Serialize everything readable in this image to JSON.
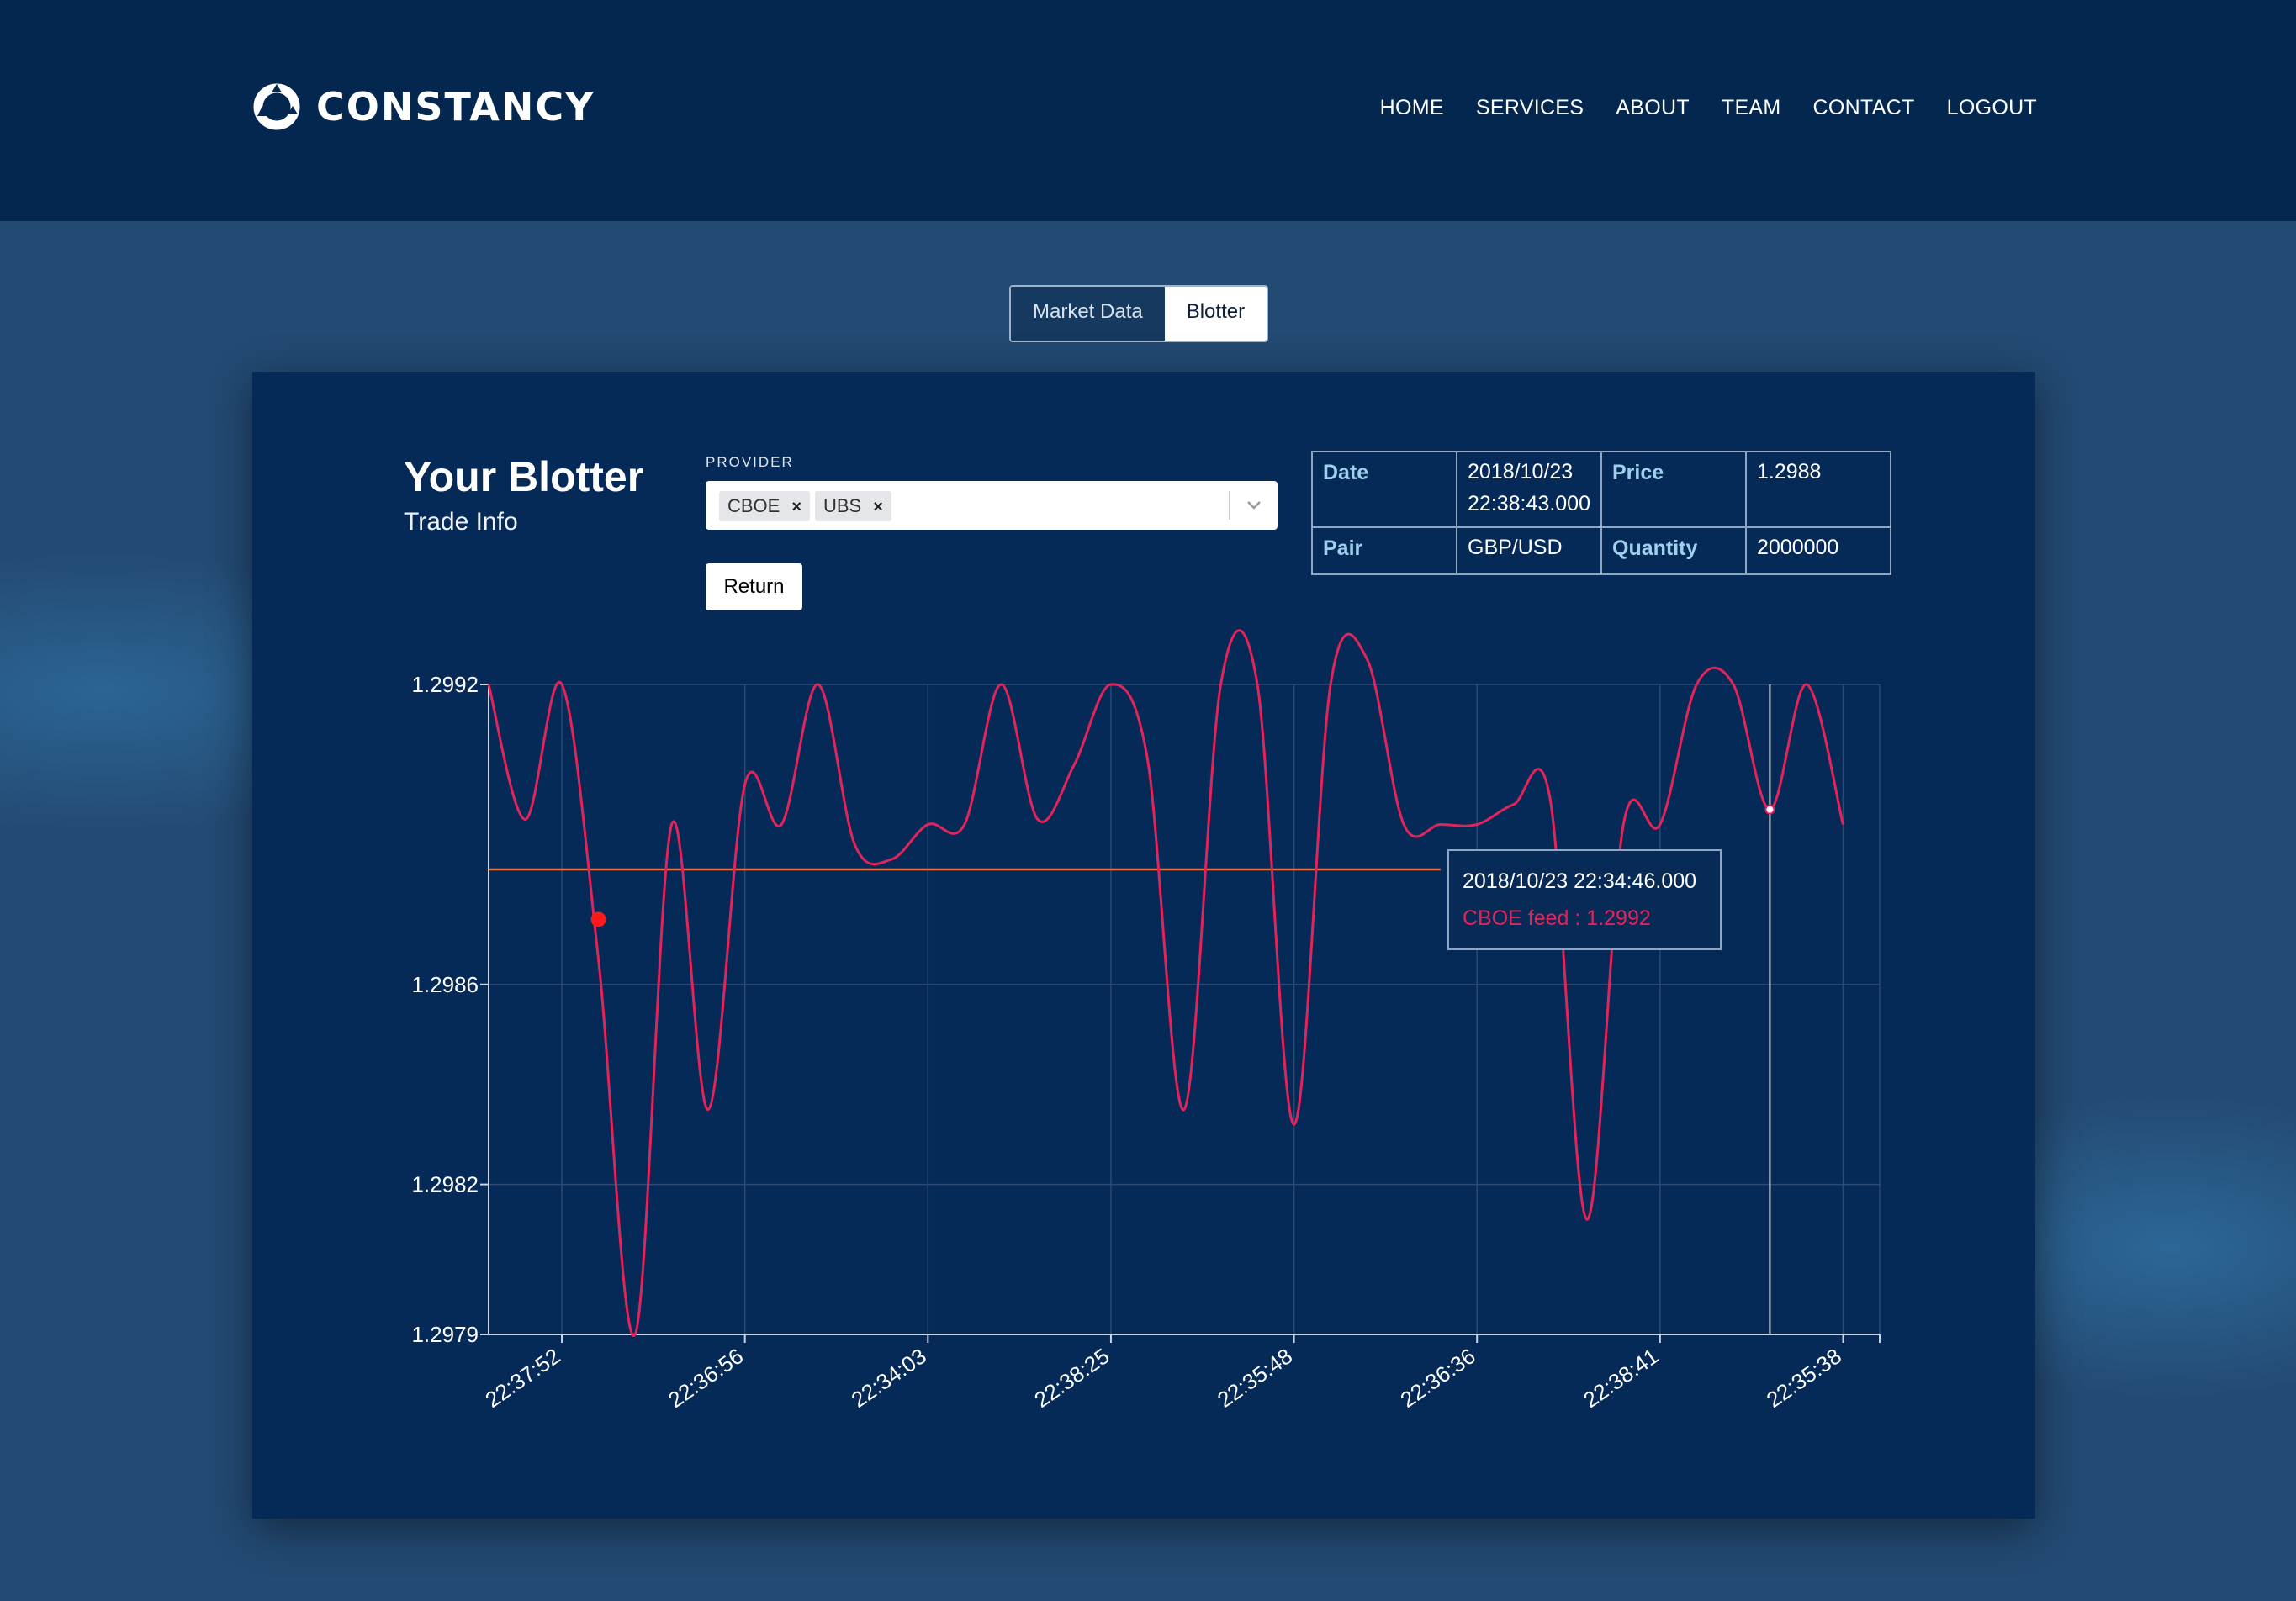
{
  "brand": {
    "name": "CONSTANCY",
    "logo_icon": "ring-logo-icon"
  },
  "nav": [
    "HOME",
    "SERVICES",
    "ABOUT",
    "TEAM",
    "CONTACT",
    "LOGOUT"
  ],
  "tabs": [
    {
      "label": "Market Data",
      "active": false
    },
    {
      "label": "Blotter",
      "active": true
    }
  ],
  "page": {
    "title": "Your Blotter",
    "subtitle": "Trade Info"
  },
  "provider": {
    "label": "PROVIDER",
    "selected": [
      "CBOE",
      "UBS"
    ],
    "remove_glyph": "×",
    "chevron_icon": "chevron-down-icon"
  },
  "return_button": "Return",
  "trade_info": {
    "date_key": "Date",
    "date_value_1": "2018/10/23",
    "date_value_2": "22:38:43.000",
    "price_key": "Price",
    "price_value": "1.2988",
    "pair_key": "Pair",
    "pair_value": "GBP/USD",
    "quantity_key": "Quantity",
    "quantity_value": "2000000"
  },
  "tooltip": {
    "time": "2018/10/23 22:34:46.000",
    "series": "CBOE feed : 1.2992"
  },
  "colors": {
    "header": "#03274f",
    "panel": "#062a57",
    "line": "#e3245a",
    "reference_line": "#e8743a",
    "marker": "#ff1a1a",
    "grid": "#2c4a72"
  },
  "chart_data": {
    "type": "line",
    "title": "",
    "xlabel": "",
    "ylabel": "",
    "ylim": [
      1.2979,
      1.2992
    ],
    "y_ticks": [
      "1.2992",
      "1.2986",
      "1.2982",
      "1.2979"
    ],
    "y_tick_values": [
      1.2992,
      1.2986,
      1.2982,
      1.2979
    ],
    "x_ticks": [
      "22:37:52",
      "22:36:56",
      "22:34:03",
      "22:38:25",
      "22:35:48",
      "22:36:36",
      "22:38:41",
      "22:35:38"
    ],
    "x_tick_positions": [
      2,
      7,
      12,
      17,
      22,
      27,
      32,
      37
    ],
    "x_max": 39,
    "grid": true,
    "series": [
      {
        "values": [
          1.2992,
          1.29893,
          1.2992,
          1.29865,
          1.2979,
          1.29892,
          1.29835,
          1.299,
          1.29892,
          1.2992,
          1.29888,
          1.29885,
          1.29892,
          1.29892,
          1.2992,
          1.29893,
          1.29904,
          1.2992,
          1.29905,
          1.29835,
          1.2992,
          1.2992,
          1.29832,
          1.2992,
          1.29925,
          1.29892,
          1.29892,
          1.29892,
          1.29896,
          1.29897,
          1.29813,
          1.29892,
          1.29892,
          1.2992,
          1.2992,
          1.29895,
          1.2992,
          1.29892
        ]
      }
    ],
    "reference_value": 1.29883,
    "reference_end_index": 26,
    "crosshair_index": 35,
    "highlight_point": {
      "index": 3,
      "value": 1.29873
    }
  }
}
